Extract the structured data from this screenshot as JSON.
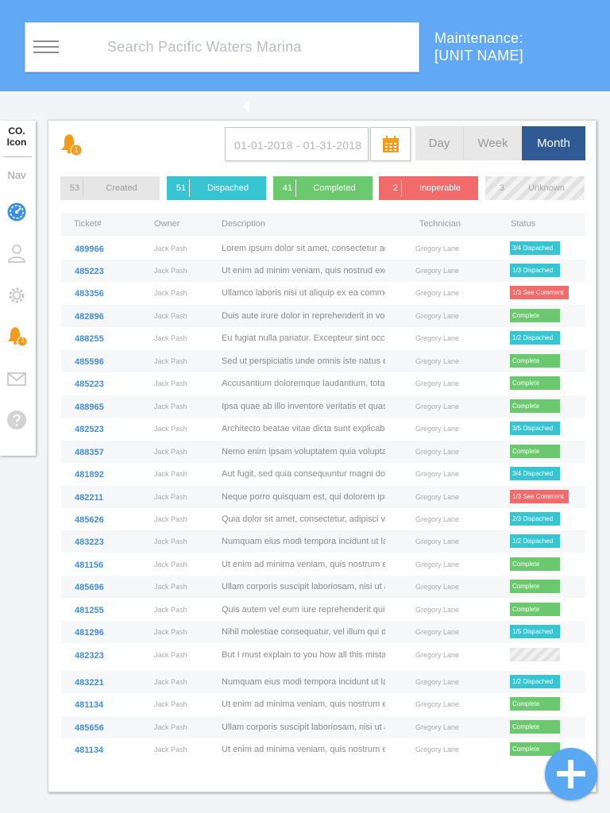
{
  "header": {
    "search_placeholder": "Search Pacific Waters Marina",
    "title_line1": "Maintenance:",
    "title_line2": "[UNIT NAME]"
  },
  "sidebar": {
    "logo_line1": "CO.",
    "logo_line2": "Icon",
    "nav_label": "Nav",
    "notification_count": "1",
    "items": [
      {
        "icon": "dashboard-gauge-icon"
      },
      {
        "icon": "user-icon"
      },
      {
        "icon": "gear-icon"
      },
      {
        "icon": "bell-icon"
      },
      {
        "icon": "mail-icon"
      },
      {
        "icon": "help-icon"
      }
    ]
  },
  "toolbar": {
    "notification_count": "1",
    "date_range": "01-01-2018 - 01-31-2018",
    "views": [
      "Day",
      "Week",
      "Month"
    ],
    "active_view": "Month"
  },
  "filters": [
    {
      "count": "53",
      "label": "Created",
      "color": "#e6e6e6"
    },
    {
      "count": "51",
      "label": "Dispached",
      "color": "#39c4d2"
    },
    {
      "count": "41",
      "label": "Completed",
      "color": "#6bc86e"
    },
    {
      "count": "2",
      "label": "Inoperable",
      "color": "#f26b6b"
    },
    {
      "count": "3",
      "label": "Unknown",
      "color": "striped"
    }
  ],
  "table": {
    "headers": [
      "Ticket#",
      "Owner",
      "Description",
      "Technician",
      "Status"
    ],
    "rows": [
      {
        "ticket": "489966",
        "owner": "Jack Pash",
        "description": "Lorem ipsum dolor sit amet, consectetur adipiscing",
        "technician": "Gregory Lane",
        "status": "3/4 Dispached",
        "type": "d"
      },
      {
        "ticket": "485223",
        "owner": "Jack Pash",
        "description": "Ut enim ad minim veniam, quis nostrud exercitation",
        "technician": "Gregory Lane",
        "status": "1/3 Dispached",
        "type": "d"
      },
      {
        "ticket": "483356",
        "owner": "Jack Pash",
        "description": "Ullamco laboris nisi ut aliquip ex ea commodo",
        "technician": "Gregory Lane",
        "status": "1/3 See Comment",
        "type": "r"
      },
      {
        "ticket": "482896",
        "owner": "Jack Pash",
        "description": "Duis aute irure dolor in reprehenderit in voluptate",
        "technician": "Gregory Lane",
        "status": "Complete",
        "type": "c"
      },
      {
        "ticket": "488255",
        "owner": "Jack Pash",
        "description": "Eu fugiat nulla pariatur. Excepteur sint occaecat",
        "technician": "Gregory Lane",
        "status": "1/2 Dispached",
        "type": "d"
      },
      {
        "ticket": "485596",
        "owner": "Jack Pash",
        "description": "Sed ut perspiciatis unde omnis iste natus error",
        "technician": "Gregory Lane",
        "status": "Complete",
        "type": "c"
      },
      {
        "ticket": "485223",
        "owner": "Jack Pash",
        "description": "Accusantium doloremque laudantium, totam rem",
        "technician": "Gregory Lane",
        "status": "Complete",
        "type": "c"
      },
      {
        "ticket": "488965",
        "owner": "Jack Pash",
        "description": "Ipsa quae ab illo inventore veritatis et quasi",
        "technician": "Gregory Lane",
        "status": "Complete",
        "type": "c"
      },
      {
        "ticket": "482523",
        "owner": "Jack Pash",
        "description": "Architecto beatae vitae dicta sunt explicabo",
        "technician": "Gregory Lane",
        "status": "3/5 Dispached",
        "type": "d"
      },
      {
        "ticket": "488357",
        "owner": "Jack Pash",
        "description": "Nemo enim ipsam voluptatem quia voluptas sit",
        "technician": "Gregory Lane",
        "status": "Complete",
        "type": "c"
      },
      {
        "ticket": "481892",
        "owner": "Jack Pash",
        "description": "Aut fugit, sed quia consequuntur magni dolores",
        "technician": "Gregory Lane",
        "status": "3/4 Dispached",
        "type": "d"
      },
      {
        "ticket": "482211",
        "owner": "Jack Pash",
        "description": "Neque porro quisquam est, qui dolorem ipsum",
        "technician": "Gregory Lane",
        "status": "1/3 See Comment",
        "type": "r"
      },
      {
        "ticket": "485626",
        "owner": "Jack Pash",
        "description": "Quia dolor sit amet, consectetur, adipisci velit",
        "technician": "Gregory Lane",
        "status": "2/3 Dispached",
        "type": "d"
      },
      {
        "ticket": "483223",
        "owner": "Jack Pash",
        "description": "Numquam eius modi tempora incidunt ut labore",
        "technician": "Gregory Lane",
        "status": "1/2 Dispached",
        "type": "d"
      },
      {
        "ticket": "481156",
        "owner": "Jack Pash",
        "description": "Ut enim ad minima veniam, quis nostrum exercitationem",
        "technician": "Gregory Lane",
        "status": "Complete",
        "type": "c"
      },
      {
        "ticket": "485696",
        "owner": "Jack Pash",
        "description": "Ullam corporis suscipit laboriosam, nisi ut aliquid",
        "technician": "Gregory Lane",
        "status": "Complete",
        "type": "c"
      },
      {
        "ticket": "481255",
        "owner": "Jack Pash",
        "description": "Quis autem vel eum iure reprehenderit qui in ea",
        "technician": "Gregory Lane",
        "status": "Complete",
        "type": "c"
      },
      {
        "ticket": "481296",
        "owner": "Jack Pash",
        "description": "Nihil molestiae consequatur, vel illum qui dolorem",
        "technician": "Gregory Lane",
        "status": "1/5 Dispached",
        "type": "d"
      },
      {
        "ticket": "482323",
        "owner": "Jack Pash",
        "description": "But I must explain to you how all this mistaken idea",
        "technician": "Gregory Lane",
        "status": "",
        "type": "u"
      },
      {
        "ticket": "483221",
        "owner": "Jack Pash",
        "description": "Numquam eius modi tempora incidunt ut labore",
        "technician": "Gregory Lane",
        "status": "1/2 Dispached",
        "type": "d"
      },
      {
        "ticket": "481134",
        "owner": "Jack Pash",
        "description": "Ut enim ad minima veniam, quis nostrum exercitationem",
        "technician": "Gregory Lane",
        "status": "Complete",
        "type": "c"
      },
      {
        "ticket": "485656",
        "owner": "Jack Pash",
        "description": "Ullam corporis suscipit laboriosam, nisi ut aliquid",
        "technician": "Gregory Lane",
        "status": "Complete",
        "type": "c"
      },
      {
        "ticket": "481134",
        "owner": "Jack Pash",
        "description": "Ut enim ad minima veniam, quis nostrum exercitationem",
        "technician": "Gregory Lane",
        "status": "Complete",
        "type": "c"
      }
    ]
  },
  "fab": {
    "icon": "plus-icon"
  }
}
